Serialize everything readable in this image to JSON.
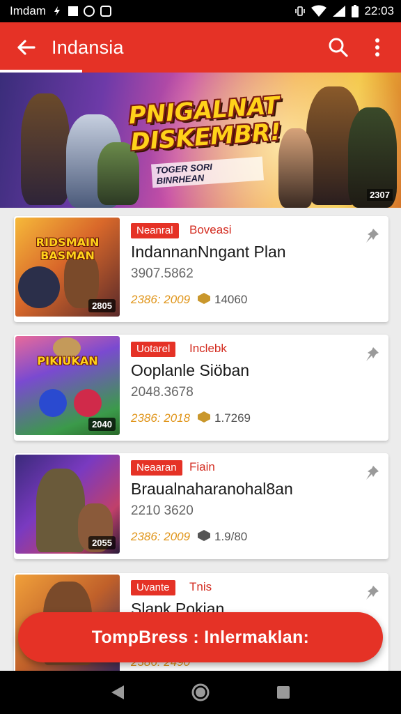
{
  "status_bar": {
    "carrier": "Imdam",
    "time": "22:03",
    "icons": [
      "bolt-icon",
      "square-icon",
      "circle-icon",
      "app-icon",
      "vibrate-icon",
      "wifi-icon",
      "signal-icon",
      "battery-icon"
    ]
  },
  "app_bar": {
    "title": "Indansia",
    "icons": [
      "back-arrow-icon",
      "search-icon",
      "more-vert-icon"
    ]
  },
  "banner": {
    "headline_line1": "PNIGALNAT",
    "headline_line2": "DISKEMBR!",
    "subtitle": "TOGER SORI BINRHEAN",
    "corner_number": "2307"
  },
  "cards": [
    {
      "thumb_title": "RIDSMAIN BASMAN",
      "thumb_badge": "2805",
      "chip": "Neanral",
      "category": "Boveasi",
      "title": "IndannanNngant Plan",
      "subtitle": "3907.5862",
      "date": "2386: 2009",
      "views": "14060"
    },
    {
      "thumb_title": "PIKIUKAN",
      "thumb_badge": "2040",
      "chip": "Uotarel",
      "category": "Inclebk",
      "title": "Ooplanle Siöban",
      "subtitle": "2048.3678",
      "date": "2386: 2018",
      "views": "1.7269"
    },
    {
      "thumb_title": "",
      "thumb_badge": "2055",
      "chip": "Neaaran",
      "category": "Fiain",
      "title": "Braualnaharanohal8an",
      "subtitle": "2210 3620",
      "date": "2386: 2009",
      "views": "1.9/80"
    },
    {
      "thumb_title": "",
      "thumb_badge": "",
      "chip": "Uvante",
      "category": "Tnis",
      "title": "Slapk Pokian",
      "subtitle": "",
      "date": "2386: 2490",
      "views": ""
    }
  ],
  "fab": {
    "label": "TompBress : Inlermaklan:"
  },
  "nav_bar": {
    "icons": [
      "back-triangle-icon",
      "home-circle-icon",
      "recents-square-icon"
    ]
  },
  "colors": {
    "primary": "#e53226",
    "status_bar": "#000000",
    "accent_gold": "#e0951a"
  }
}
